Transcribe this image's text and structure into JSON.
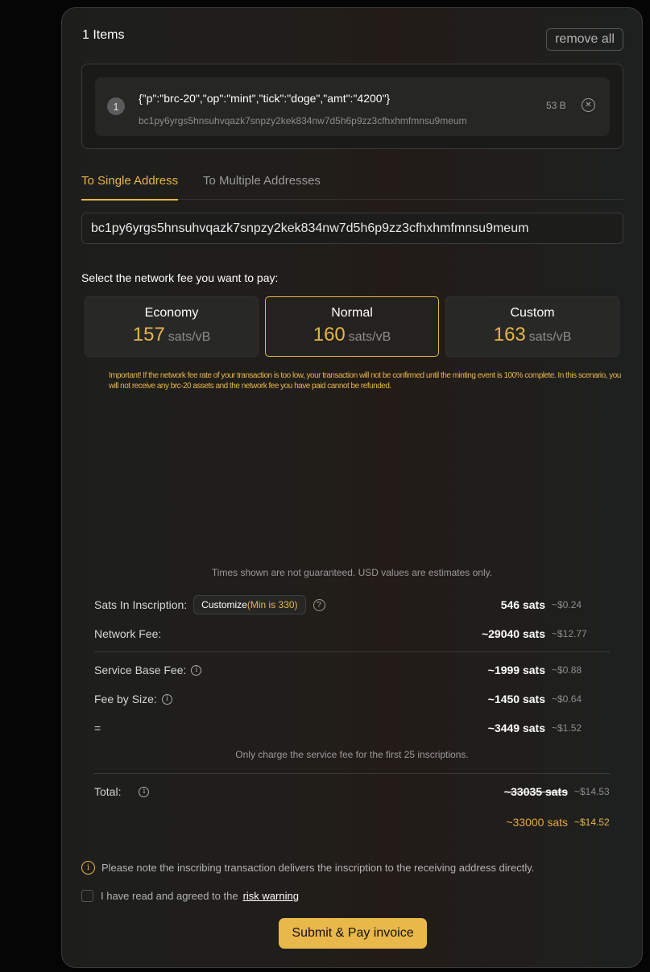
{
  "items_header": {
    "title": "1 Items",
    "remove_all_label": "remove all"
  },
  "items": [
    {
      "index": "1",
      "content": "{\"p\":\"brc-20\",\"op\":\"mint\",\"tick\":\"doge\",\"amt\":\"4200\"}",
      "address": "bc1py6yrgs5hnsuhvqazk7snpzy2kek834nw7d5h6p9zz3cfhxhmfmnsu9meum",
      "size": "53 B",
      "remove_icon": "close-circle-icon"
    }
  ],
  "tabs": [
    {
      "label": "To Single Address",
      "active": true
    },
    {
      "label": "To Multiple Addresses",
      "active": false
    }
  ],
  "address_input": {
    "value": "bc1py6yrgs5hnsuhvqazk7snpzy2kek834nw7d5h6p9zz3cfhxhmfmnsu9meum"
  },
  "fee_select": {
    "label": "Select the network fee you want to pay:",
    "options": [
      {
        "name": "Economy",
        "rate": "157",
        "unit": "sats/vB",
        "selected": false
      },
      {
        "name": "Normal",
        "rate": "160",
        "unit": "sats/vB",
        "selected": true
      },
      {
        "name": "Custom",
        "rate": "163",
        "unit": "sats/vB",
        "selected": false
      }
    ],
    "warning": "Important! If the network fee rate of your transaction is too low, your transaction will not be confirmed until the minting event is 100% complete. In this scenario, you will not receive any brc-20 assets and the network fee you have paid cannot be refunded."
  },
  "summary": {
    "disclaimer": "Times shown are not guaranteed. USD values are estimates only.",
    "sats_in_inscription": {
      "label": "Sats In Inscription:",
      "customize_label": "Customize",
      "customize_min": "(Min is 330)",
      "sats": "546 sats",
      "usd": "~$0.24"
    },
    "network_fee": {
      "label": "Network Fee:",
      "sats": "~29040 sats",
      "usd": "~$12.77"
    },
    "service_base_fee": {
      "label": "Service Base Fee:",
      "sats": "~1999 sats",
      "usd": "~$0.88"
    },
    "fee_by_size": {
      "label": "Fee by Size:",
      "sats": "~1450 sats",
      "usd": "~$0.64"
    },
    "subtotal": {
      "label": "=",
      "sats": "~3449 sats",
      "usd": "~$1.52"
    },
    "service_note": "Only charge the service fee for the first 25 inscriptions.",
    "total": {
      "label": "Total:",
      "original_sats": "~33035 sats",
      "original_usd": "~$14.53",
      "final_sats": "~33000 sats",
      "final_usd": "~$14.52"
    }
  },
  "note": "Please note the inscribing transaction delivers the inscription to the receiving address directly.",
  "agreement": {
    "text": "I have read and agreed to the",
    "link": "risk warning",
    "checked": false
  },
  "submit_label": "Submit & Pay invoice",
  "colors": {
    "accent": "#e7b54a",
    "background": "#050505",
    "panel": "#1f1e1b"
  }
}
